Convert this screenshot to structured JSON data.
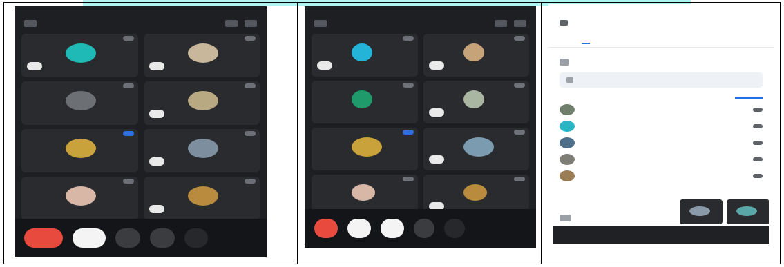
{
  "colors": {
    "call_bg": "#1e1f22",
    "tile_bg": "#2a2b2f",
    "end_call": "#e84a3e",
    "accent": "#1a73e8"
  },
  "screen1": {
    "status_left": "",
    "status_right": "",
    "title": "",
    "tiles": [
      {
        "name": "",
        "badge": "",
        "avatar": "#1fbab6"
      },
      {
        "name": "",
        "badge": "",
        "avatar": "#c8b79a"
      },
      {
        "name": "",
        "badge": "",
        "avatar": "#6c6f74"
      },
      {
        "name": "",
        "badge": "",
        "avatar": "#b9a982"
      },
      {
        "name": "",
        "badge": "",
        "avatar": "#c9a23b"
      },
      {
        "name": "",
        "badge": "",
        "avatar": "#7d8e9e"
      },
      {
        "name": "",
        "badge": "",
        "avatar": "#d8b7a6"
      },
      {
        "name": "",
        "badge": "",
        "avatar": "#b98b3f"
      }
    ],
    "controls": {
      "end": "",
      "cam": "",
      "mic": "",
      "more": "",
      "extra": ""
    }
  },
  "screen2": {
    "status_left": "",
    "status_right": "",
    "title": "",
    "tiles": [
      {
        "name": "",
        "badge": "",
        "avatar": "#23b4d8"
      },
      {
        "name": "",
        "badge": "",
        "avatar": "#c7a37a"
      },
      {
        "name": "",
        "badge": "",
        "avatar": "#1f9a6a"
      },
      {
        "name": "",
        "badge": "",
        "avatar": "#a9b7a2"
      },
      {
        "name": "",
        "badge": "",
        "avatar": "#c9a23b"
      },
      {
        "name": "",
        "badge": "",
        "avatar": "#7a9bb0"
      },
      {
        "name": "",
        "badge": "",
        "avatar": "#d8b7a6"
      },
      {
        "name": "",
        "badge": "",
        "avatar": "#b98b3f"
      }
    ],
    "controls": {
      "end": "",
      "cam": "",
      "mic": "",
      "more": "",
      "extra": ""
    }
  },
  "screen3": {
    "status_left": "",
    "status_right": "",
    "title": "",
    "tabs": [
      "",
      "",
      ""
    ],
    "section_label": "",
    "add_people": "",
    "search_text": "",
    "pinned_label": "",
    "people": [
      {
        "name": "",
        "avatar": "#6f7f6b"
      },
      {
        "name": "",
        "avatar": "#2bb4c4"
      },
      {
        "name": "",
        "avatar": "#4d6f8a"
      },
      {
        "name": "",
        "avatar": "#7e7e76"
      },
      {
        "name": "",
        "avatar": "#9a7d55"
      }
    ],
    "sharing_label": "",
    "toast_text": ""
  }
}
